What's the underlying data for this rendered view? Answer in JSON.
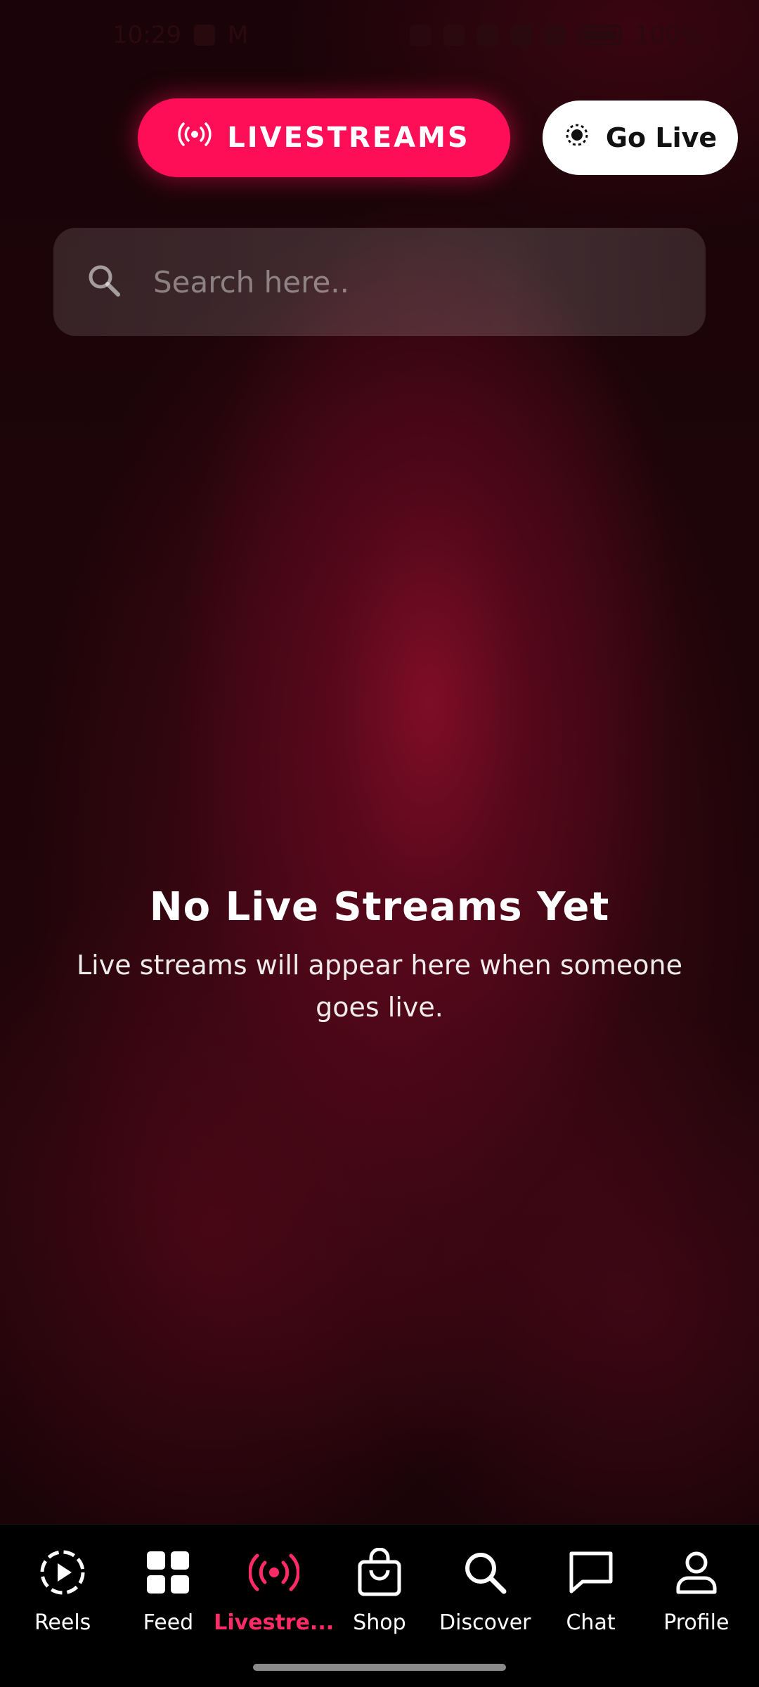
{
  "status_bar": {
    "time": "10:29",
    "indicator": "M",
    "battery": "100%"
  },
  "header": {
    "livestreams_label": "LIVESTREAMS",
    "go_live_label": "Go Live"
  },
  "search": {
    "placeholder": "Search here.."
  },
  "empty_state": {
    "title": "No Live Streams Yet",
    "subtitle": "Live streams will appear here when someone goes live."
  },
  "nav": {
    "items": [
      {
        "label": "Reels",
        "icon": "reels-icon"
      },
      {
        "label": "Feed",
        "icon": "grid-icon"
      },
      {
        "label": "Livestre...",
        "icon": "broadcast-icon",
        "active": true
      },
      {
        "label": "Shop",
        "icon": "shopping-bag-icon"
      },
      {
        "label": "Discover",
        "icon": "search-icon"
      },
      {
        "label": "Chat",
        "icon": "chat-bubble-icon"
      },
      {
        "label": "Profile",
        "icon": "person-icon"
      }
    ]
  },
  "colors": {
    "accent": "#ff0e58",
    "active_nav": "#ff2b66",
    "background": "#1e0509"
  }
}
